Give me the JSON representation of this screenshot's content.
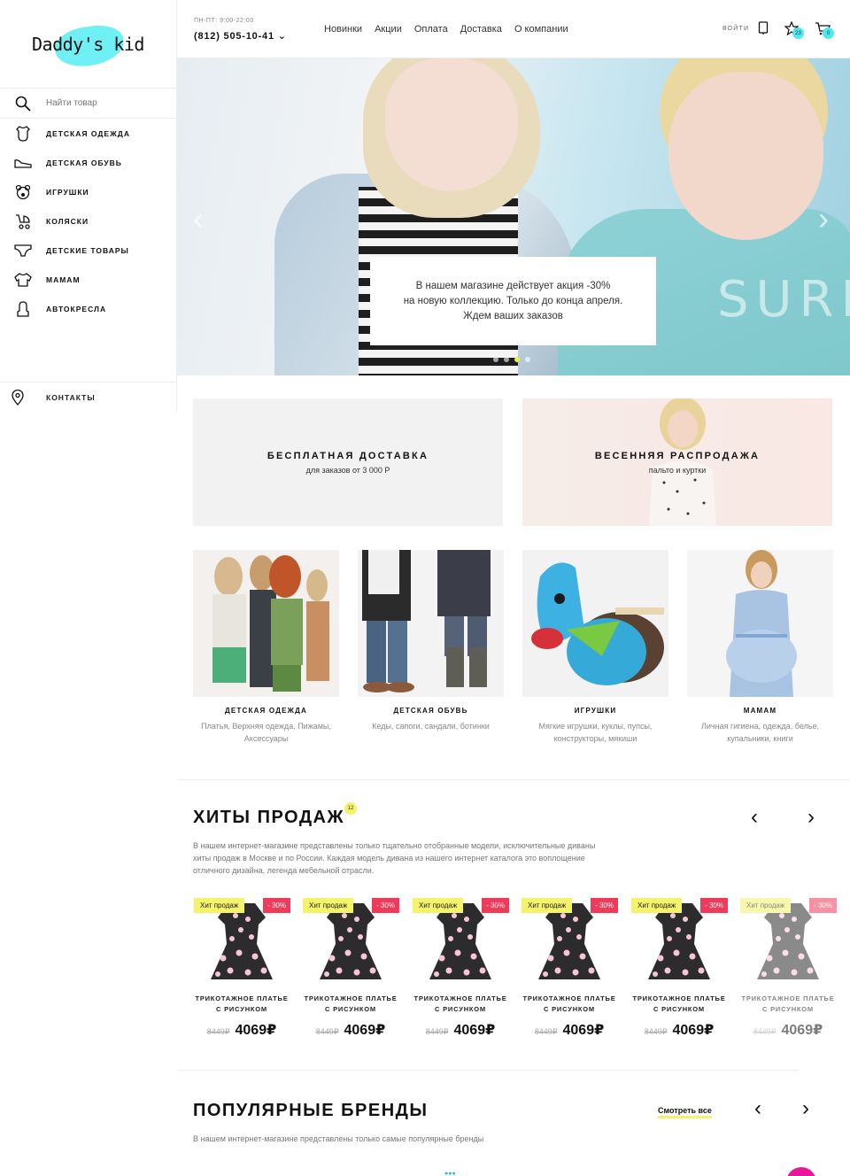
{
  "brand": {
    "logo_text": "Daddy's kid"
  },
  "header": {
    "hours": "ПН-ПТ: 9:00-22:00",
    "phone": "(812) 505-10-41 ⌄",
    "nav": [
      "Новинки",
      "Акции",
      "Оплата",
      "Доставка",
      "О компании"
    ],
    "login": "ВОЙТИ",
    "favorites_count": "23",
    "cart_count": "0"
  },
  "sidebar": {
    "search_placeholder": "Найти товар",
    "items": [
      {
        "label": "Детская одежда",
        "icon": "bodysuit-icon"
      },
      {
        "label": "Детская обувь",
        "icon": "shoe-icon"
      },
      {
        "label": "Игрушки",
        "icon": "teddy-bear-icon"
      },
      {
        "label": "Коляски",
        "icon": "stroller-icon"
      },
      {
        "label": "Детские товары",
        "icon": "diaper-icon"
      },
      {
        "label": "Мамам",
        "icon": "sweater-icon"
      },
      {
        "label": "Автокресла",
        "icon": "car-seat-icon"
      }
    ],
    "contacts": "КОНТАКТЫ"
  },
  "hero": {
    "lines": [
      "В нашем магазине действует акция -30%",
      "на новую коллекцию. Только до конца апреля.",
      "Ждем ваших заказов"
    ],
    "shirt_text": "SURF",
    "active_slide": 3,
    "slides": 4
  },
  "banners": [
    {
      "title": "БЕСПЛАТНАЯ ДОСТАВКА",
      "subtitle": "для заказов от 3 000 Р"
    },
    {
      "title": "ВЕСЕННЯЯ РАСПРОДАЖА",
      "subtitle": "пальто и куртки"
    }
  ],
  "categories": [
    {
      "title": "ДЕТСКАЯ ОДЕЖДА",
      "subtitle": "Платья, Верхняя одежда, Пижамы, Аксессуары"
    },
    {
      "title": "ДЕТСКАЯ ОБУВЬ",
      "subtitle": "Кеды, сапоги, сандали, ботинки"
    },
    {
      "title": "ИГРУШКИ",
      "subtitle": "Мягкие игрушки, куклы, пупсы, конструкторы, мякиши"
    },
    {
      "title": "МАМАМ",
      "subtitle": "Личная гигиена, одежда, белье, купальники, книги"
    }
  ],
  "hits": {
    "title": "ХИТЫ ПРОДАЖ",
    "count": "12",
    "description": "В нашем интернет-магазине представлены только тщательно отобранные модели, исключительные диваны хиты продаж в Москве и по России. Каждая модель дивана из нашего интернет каталога это воплощение отличного дизайна, легенда мебельной отрасли.",
    "products": [
      {
        "badge": "Хит продаж",
        "discount": "- 30%",
        "name": "ТРИКОТАЖНОЕ ПЛАТЬЕ С РИСУНКОМ",
        "old_price": "8449₽",
        "price": "4069₽"
      },
      {
        "badge": "Хит продаж",
        "discount": "- 30%",
        "name": "ТРИКОТАЖНОЕ ПЛАТЬЕ С РИСУНКОМ",
        "old_price": "8449₽",
        "price": "4069₽"
      },
      {
        "badge": "Хит продаж",
        "discount": "- 30%",
        "name": "ТРИКОТАЖНОЕ ПЛАТЬЕ С РИСУНКОМ",
        "old_price": "8449₽",
        "price": "4069₽"
      },
      {
        "badge": "Хит продаж",
        "discount": "- 30%",
        "name": "ТРИКОТАЖНОЕ ПЛАТЬЕ С РИСУНКОМ",
        "old_price": "8449₽",
        "price": "4069₽"
      },
      {
        "badge": "Хит продаж",
        "discount": "- 30%",
        "name": "ТРИКОТАЖНОЕ ПЛАТЬЕ С РИСУНКОМ",
        "old_price": "8449₽",
        "price": "4069₽"
      },
      {
        "badge": "Хит продаж",
        "discount": "- 30%",
        "name": "ТРИКОТАЖНОЕ ПЛАТЬЕ С РИСУНКОМ",
        "old_price": "8449₽",
        "price": "4069₽"
      }
    ]
  },
  "brands": {
    "title": "ПОПУЛЯРНЫЕ БРЕНДЫ",
    "see_all": "Смотреть все",
    "description": "В нашем интернет-магазине представлены только самые популярные бренды"
  },
  "colors": {
    "accent_cyan": "#4ee8f0",
    "accent_yellow": "#f4f36a",
    "sale_red": "#f03a5a"
  }
}
